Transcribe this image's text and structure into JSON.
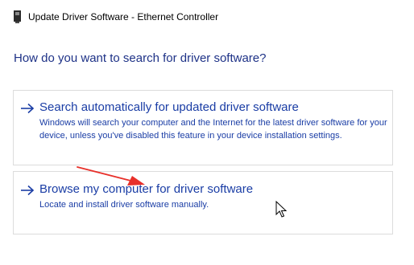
{
  "window": {
    "title": "Update Driver Software - Ethernet Controller",
    "icon": "device-driver-icon"
  },
  "heading": "How do you want to search for driver software?",
  "options": [
    {
      "title": "Search automatically for updated driver software",
      "description": "Windows will search your computer and the Internet for the latest driver software for your device, unless you've disabled this feature in your device installation settings.",
      "icon": "arrow-right-icon"
    },
    {
      "title": "Browse my computer for driver software",
      "description": "Locate and install driver software manually.",
      "icon": "arrow-right-icon"
    }
  ],
  "colors": {
    "heading": "#1e3287",
    "link": "#1a3da5",
    "annotation": "#e8302a",
    "border": "#dcdcdc"
  }
}
